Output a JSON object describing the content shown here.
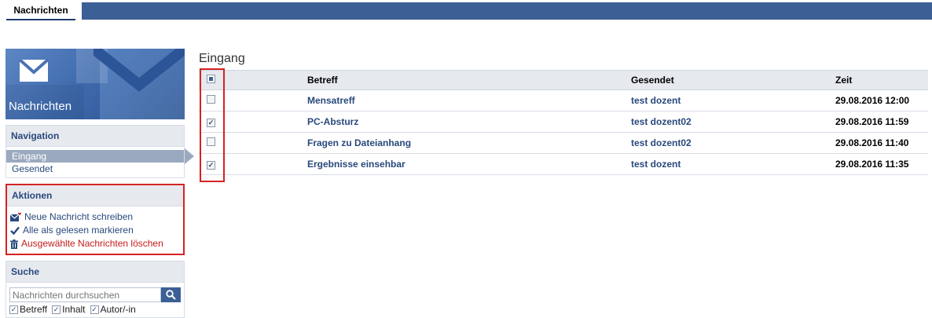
{
  "top_tab": "Nachrichten",
  "sidebar": {
    "title": "Nachrichten",
    "navigation": {
      "heading": "Navigation",
      "items": [
        {
          "label": "Eingang",
          "active": true
        },
        {
          "label": "Gesendet",
          "active": false
        }
      ]
    },
    "actions": {
      "heading": "Aktionen",
      "items": [
        {
          "label": "Neue Nachricht schreiben",
          "icon": "new-message-icon"
        },
        {
          "label": "Alle als gelesen markieren",
          "icon": "checkmark-icon"
        },
        {
          "label": "Ausgewählte Nachrichten löschen",
          "icon": "trash-icon"
        }
      ]
    },
    "search": {
      "heading": "Suche",
      "placeholder": "Nachrichten durchsuchen",
      "filters": [
        {
          "label": "Betreff",
          "checked": true
        },
        {
          "label": "Inhalt",
          "checked": true
        },
        {
          "label": "Autor/-in",
          "checked": true
        }
      ]
    }
  },
  "main": {
    "heading": "Eingang",
    "columns": [
      "Betreff",
      "Gesendet",
      "Zeit"
    ],
    "rows": [
      {
        "checked": false,
        "subject": "Mensatreff",
        "sender": "test dozent",
        "time": "29.08.2016 12:00"
      },
      {
        "checked": true,
        "subject": "PC-Absturz",
        "sender": "test dozent02",
        "time": "29.08.2016 11:59"
      },
      {
        "checked": false,
        "subject": "Fragen zu Dateianhang",
        "sender": "test dozent02",
        "time": "29.08.2016 11:40"
      },
      {
        "checked": true,
        "subject": "Ergebnisse einsehbar",
        "sender": "test dozent",
        "time": "29.08.2016 11:35"
      }
    ]
  },
  "colors": {
    "accent": "#3c5f95",
    "link": "#28497c",
    "danger": "#c41c1c",
    "highlight": "#d62222"
  }
}
